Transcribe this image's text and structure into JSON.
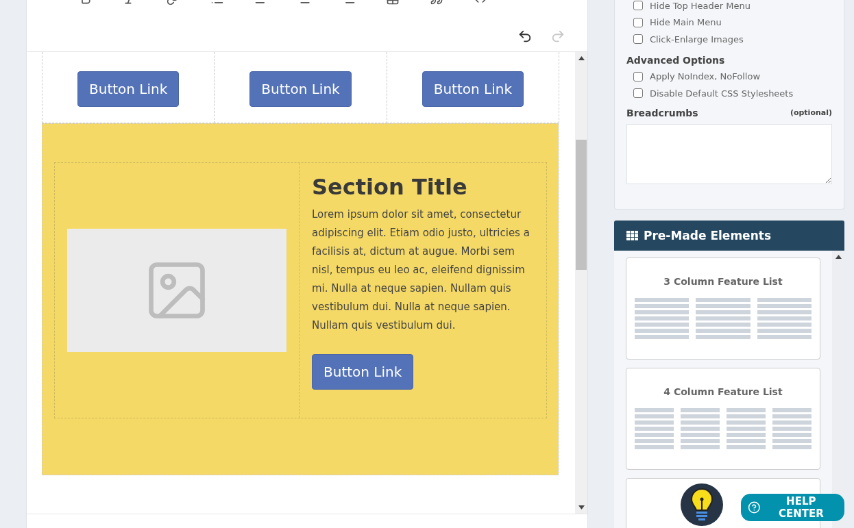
{
  "editor": {
    "undo_enabled": true,
    "redo_enabled": false,
    "feature_buttons": [
      "Button Link",
      "Button Link",
      "Button Link"
    ],
    "section": {
      "title": "Section Title",
      "body": "Lorem ipsum dolor sit amet, consectetur adipiscing elit. Etiam odio justo, ultricies a facilisis at, dictum at augue. Morbi sem nisl, tempus eu leo ac, eleifend dignissim mi. Nulla at neque sapien. Nullam quis vestibulum dui. Nulla at neque sapien. Nullam quis vestibulum dui.",
      "button": "Button Link"
    }
  },
  "settings": {
    "options": [
      {
        "label": "Hide Top Header Menu",
        "checked": false
      },
      {
        "label": "Hide Main Menu",
        "checked": false
      },
      {
        "label": "Click-Enlarge Images",
        "checked": false
      }
    ],
    "advanced_title": "Advanced Options",
    "advanced_options": [
      {
        "label": "Apply NoIndex, NoFollow",
        "checked": false
      },
      {
        "label": "Disable Default CSS Stylesheets",
        "checked": false
      }
    ],
    "breadcrumbs": {
      "label": "Breadcrumbs",
      "hint": "(optional)"
    }
  },
  "premade": {
    "title": "Pre-Made Elements",
    "items": [
      {
        "title": "3 Column Feature List",
        "kind": "three"
      },
      {
        "title": "4 Column Feature List",
        "kind": "four"
      },
      {
        "kind": "blank"
      }
    ]
  },
  "help": {
    "label": "HELP CENTER"
  }
}
